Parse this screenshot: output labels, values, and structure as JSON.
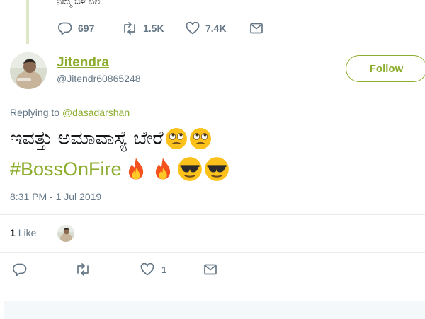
{
  "quoted": {
    "text_fragment": "ನಿಮ್ಮ ಬಳಿ ಬಲ",
    "reply_count": "697",
    "retweet_count": "1.5K",
    "like_count": "7.4K"
  },
  "author": {
    "name": "Jitendra",
    "handle": "@Jitendr60865248"
  },
  "follow_label": "Follow",
  "replying": {
    "prefix": "Replying to",
    "mention": "@dasadarshan"
  },
  "tweet": {
    "line1": "ಇವತ್ತು ಅಮಾವಾಸ್ಯೆ ಬೇರೆ",
    "hashtag": "#BossOnFire",
    "emoji_line1": [
      "rolling-eyes",
      "rolling-eyes"
    ],
    "emoji_line2": [
      "fire",
      "fire",
      "sunglasses",
      "sunglasses"
    ]
  },
  "timestamp": "8:31 PM - 1 Jul 2019",
  "likes": {
    "count": "1",
    "label": "Like"
  },
  "actions": {
    "like_count": "1"
  },
  "colors": {
    "accent": "#8dad2f",
    "muted": "#657786",
    "border": "#e6ecf0"
  },
  "icons": [
    "reply-icon",
    "retweet-icon",
    "heart-icon",
    "dm-icon"
  ]
}
